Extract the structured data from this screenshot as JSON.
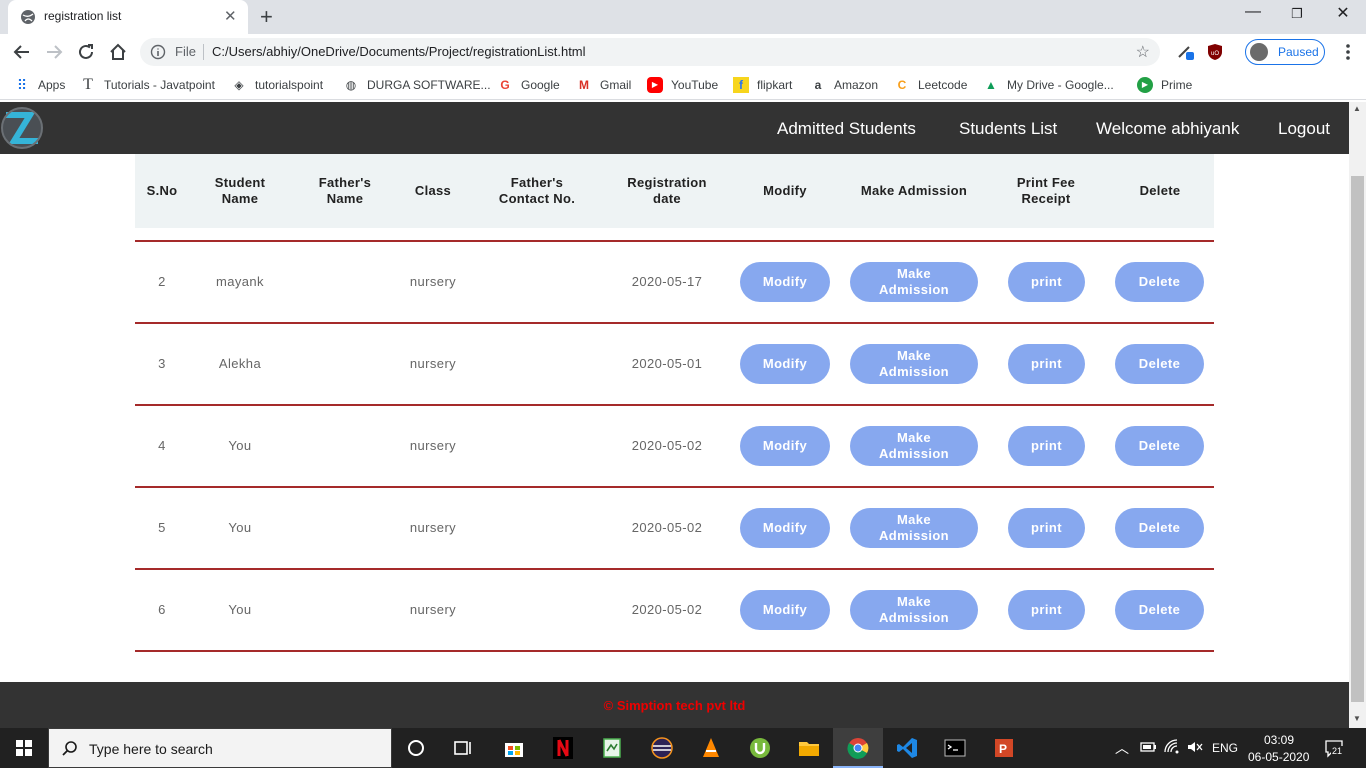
{
  "browser": {
    "tab_title": "registration list",
    "file_label": "File",
    "url": "C:/Users/abhiy/OneDrive/Documents/Project/registrationList.html",
    "profile_status": "Paused",
    "bookmarks": [
      {
        "label": "Apps",
        "icon": "apps-grid-icon"
      },
      {
        "label": "Tutorials - Javatpoint",
        "icon": "javatpoint-icon"
      },
      {
        "label": "tutorialspoint",
        "icon": "tutorialspoint-icon"
      },
      {
        "label": "DURGA SOFTWARE...",
        "icon": "globe-icon"
      },
      {
        "label": "Google",
        "icon": "google-icon"
      },
      {
        "label": "Gmail",
        "icon": "gmail-icon"
      },
      {
        "label": "YouTube",
        "icon": "youtube-icon"
      },
      {
        "label": "flipkart",
        "icon": "flipkart-icon"
      },
      {
        "label": "Amazon",
        "icon": "amazon-icon"
      },
      {
        "label": "Leetcode",
        "icon": "leetcode-icon"
      },
      {
        "label": "My Drive - Google...",
        "icon": "google-drive-icon"
      },
      {
        "label": "Prime",
        "icon": "prime-icon"
      }
    ]
  },
  "nav": {
    "links": [
      "Admitted Students",
      "Students List",
      "Welcome abhiyank",
      "Logout"
    ]
  },
  "table": {
    "headers": [
      "S.No",
      "Student Name",
      "Father's Name",
      "Class",
      "Father's Contact No.",
      "Registration date",
      "Modify",
      "Make Admission",
      "Print Fee Receipt",
      "Delete"
    ],
    "rows": [
      {
        "sno": "2",
        "student": "mayank",
        "father": "",
        "class": "nursery",
        "contact": "",
        "date": "2020-05-17"
      },
      {
        "sno": "3",
        "student": "Alekha",
        "father": "",
        "class": "nursery",
        "contact": "",
        "date": "2020-05-01"
      },
      {
        "sno": "4",
        "student": "You",
        "father": "",
        "class": "nursery",
        "contact": "",
        "date": "2020-05-02"
      },
      {
        "sno": "5",
        "student": "You",
        "father": "",
        "class": "nursery",
        "contact": "",
        "date": "2020-05-02"
      },
      {
        "sno": "6",
        "student": "You",
        "father": "",
        "class": "nursery",
        "contact": "",
        "date": "2020-05-02"
      }
    ],
    "buttons": {
      "modify": "Modify",
      "admission": "Make Admission",
      "print": "print",
      "delete": "Delete"
    }
  },
  "footer": {
    "text": "© Simption tech pvt ltd"
  },
  "taskbar": {
    "search_placeholder": "Type here to search",
    "language": "ENG",
    "time": "03:09",
    "date": "06-05-2020",
    "notification_count": "21"
  },
  "colors": {
    "navbar": "#333333",
    "button": "#87a8ef",
    "row_divider": "#a52a2a",
    "header_bg": "#eef3f4",
    "footer_text": "#ee0000"
  }
}
